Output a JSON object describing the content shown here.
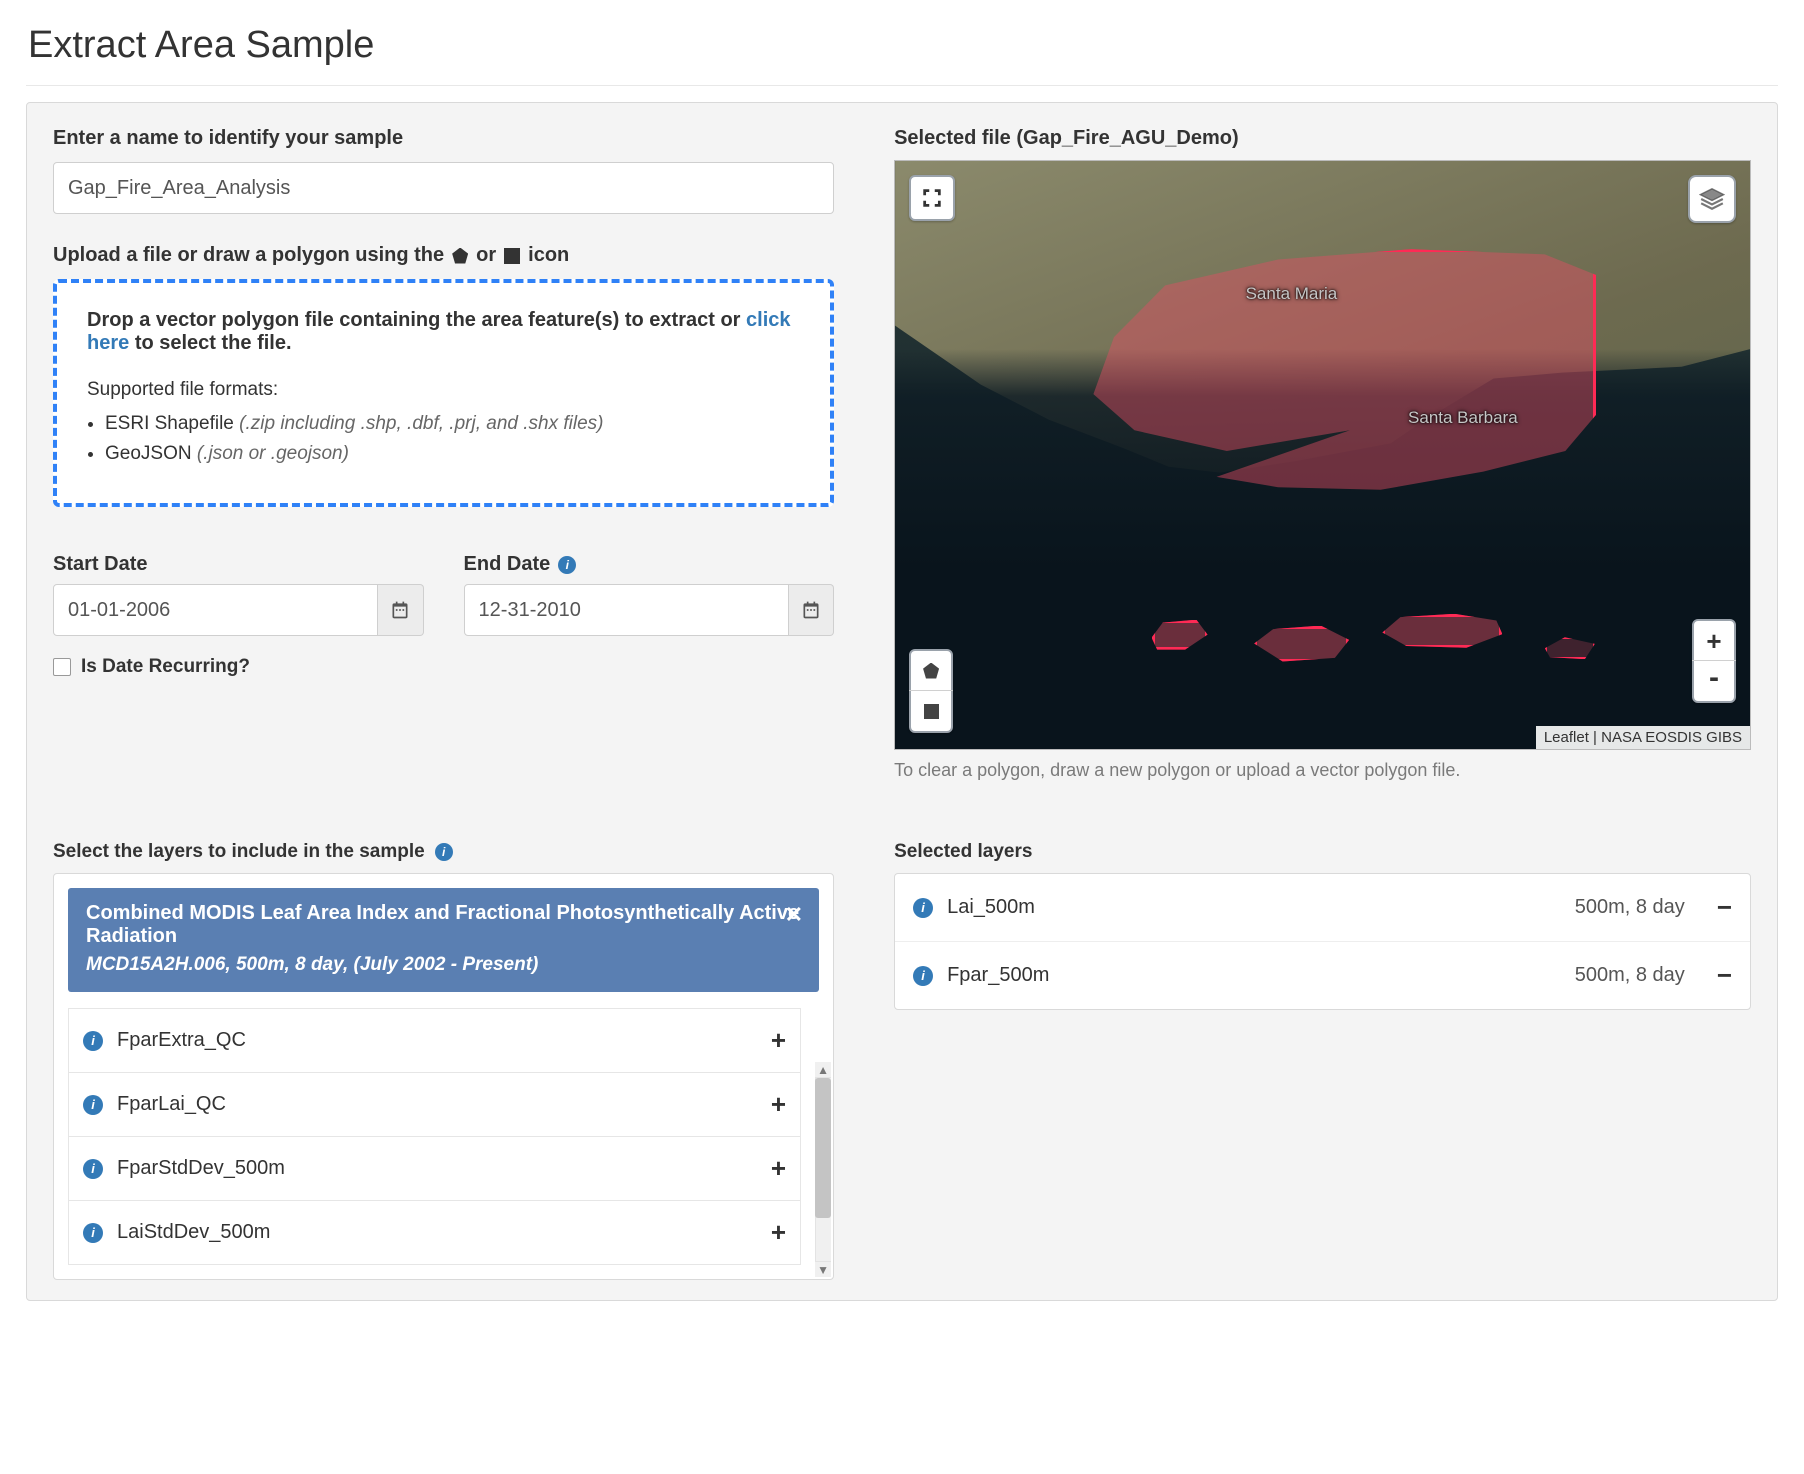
{
  "page": {
    "title": "Extract Area Sample"
  },
  "sample_name": {
    "label": "Enter a name to identify your sample",
    "value": "Gap_Fire_Area_Analysis"
  },
  "upload": {
    "intro_prefix": "Upload a file or draw a polygon using the",
    "or": "or",
    "intro_suffix": "icon",
    "dz_text_prefix": "Drop a vector polygon file containing the area feature(s) to extract or",
    "dz_link": "click here",
    "dz_text_suffix": "to select the file.",
    "supported": "Supported file formats:",
    "formats": [
      {
        "name": "ESRI Shapefile",
        "hint": "(.zip including .shp, .dbf, .prj, and .shx files)"
      },
      {
        "name": "GeoJSON",
        "hint": "(.json or .geojson)"
      }
    ]
  },
  "dates": {
    "start_label": "Start Date",
    "end_label": "End Date",
    "start_value": "01-01-2006",
    "end_value": "12-31-2010",
    "recurring_label": "Is Date Recurring?"
  },
  "map": {
    "title_prefix": "Selected file",
    "selected_file": "Gap_Fire_AGU_Demo",
    "city1": "Santa Maria",
    "city2": "Santa Barbara",
    "attribution": "Leaflet | NASA EOSDIS GIBS",
    "note": "To clear a polygon, draw a new polygon or upload a vector polygon file."
  },
  "layers": {
    "select_label": "Select the layers to include in the sample",
    "header_title": "Combined MODIS Leaf Area Index and Fractional Photosynthetically Active Radiation",
    "header_sub": "MCD15A2H.006, 500m, 8 day, (July 2002 - Present)",
    "available": [
      "FparExtra_QC",
      "FparLai_QC",
      "FparStdDev_500m",
      "LaiStdDev_500m"
    ],
    "selected_label": "Selected layers",
    "selected": [
      {
        "name": "Lai_500m",
        "meta": "500m, 8 day"
      },
      {
        "name": "Fpar_500m",
        "meta": "500m, 8 day"
      }
    ]
  }
}
